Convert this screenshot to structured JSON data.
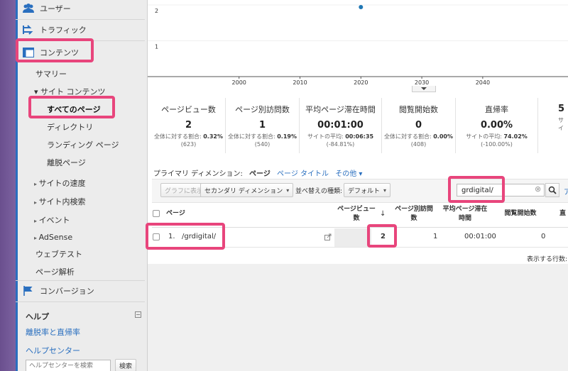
{
  "sidebar": {
    "top_items": [
      {
        "label": "ユーザー",
        "icon": "users-icon"
      },
      {
        "label": "トラフィック",
        "icon": "traffic-icon"
      },
      {
        "label": "コンテンツ",
        "icon": "content-icon"
      }
    ],
    "content_sub": {
      "summary": "サマリー",
      "site_content": "▾ サイト コンテンツ",
      "all_pages": "すべてのページ",
      "directory": "ディレクトリ",
      "landing": "ランディング ページ",
      "exit": "離脱ページ",
      "site_speed": "サイトの速度",
      "site_search": "サイト内検索",
      "events": "イベント",
      "adsense": "AdSense",
      "web_test": "ウェブテスト",
      "page_analysis": "ページ解析"
    },
    "conversion": "コンバージョン",
    "help": {
      "title": "ヘルプ",
      "link": "離脱率と直帰率",
      "center": "ヘルプセンター",
      "search_placeholder": "ヘルプセンターを検索",
      "search_button": "検索"
    }
  },
  "chart_data": {
    "type": "scatter",
    "x": [
      2020
    ],
    "y": [
      2
    ],
    "xticks": [
      "2000",
      "2010",
      "2020",
      "2030",
      "2040"
    ],
    "yticks": [
      "2",
      "1"
    ],
    "xlim": [
      1985,
      2054
    ],
    "ylim": [
      0,
      2.1
    ],
    "color": "#1f77b4"
  },
  "metrics": [
    {
      "title": "ページビュー数",
      "value": "2",
      "sub1_pre": "全体に対する割合: ",
      "sub1_val": "0.32%",
      "sub2": "(623)"
    },
    {
      "title": "ページ別訪問数",
      "value": "1",
      "sub1_pre": "全体に対する割合: ",
      "sub1_val": "0.19%",
      "sub2": "(540)"
    },
    {
      "title": "平均ページ滞在時間",
      "value": "00:01:00",
      "sub1_pre": "サイトの平均: ",
      "sub1_val": "00:06:35",
      "sub2": "(-84.81%)"
    },
    {
      "title": "閲覧開始数",
      "value": "0",
      "sub1_pre": "全体に対する割合: ",
      "sub1_val": "0.00%",
      "sub2": "(408)"
    },
    {
      "title": "直帰率",
      "value": "0.00%",
      "sub1_pre": "サイトの平均: ",
      "sub1_val": "74.02%",
      "sub2": "(-100.00%)"
    },
    {
      "title": "",
      "value": "5",
      "sub1_pre": "サイ",
      "sub1_val": "",
      "sub2": ""
    }
  ],
  "dimension": {
    "label": "プライマリ ディメンション:",
    "active": "ページ",
    "page_title": "ページ タイトル",
    "other": "その他 ▾"
  },
  "toolbar": {
    "graph_btn": "グラフに表示",
    "secondary": "セカンダリ ディメンション",
    "sort_label": "並べ替えの種類:",
    "sort_value": "デフォルト",
    "search_value": "grdigital/",
    "clear": "⊗"
  },
  "table": {
    "headers": {
      "page": "ページ",
      "pv": "ページビュー\n数",
      "visits": "ページ別訪問\n数",
      "avg_time": "平均ページ滞在\n時間",
      "entrances": "閲覧開始数",
      "bounce": "直"
    },
    "rows": [
      {
        "index": "1.",
        "page": "/grdigital/",
        "pv": "2",
        "visits": "1",
        "avg_time": "00:01:00",
        "entrances": "0"
      }
    ]
  },
  "footer": {
    "rows_label": "表示する行数:"
  },
  "colors": {
    "accent": "#2a6fbf",
    "highlight": "#e8457c"
  }
}
